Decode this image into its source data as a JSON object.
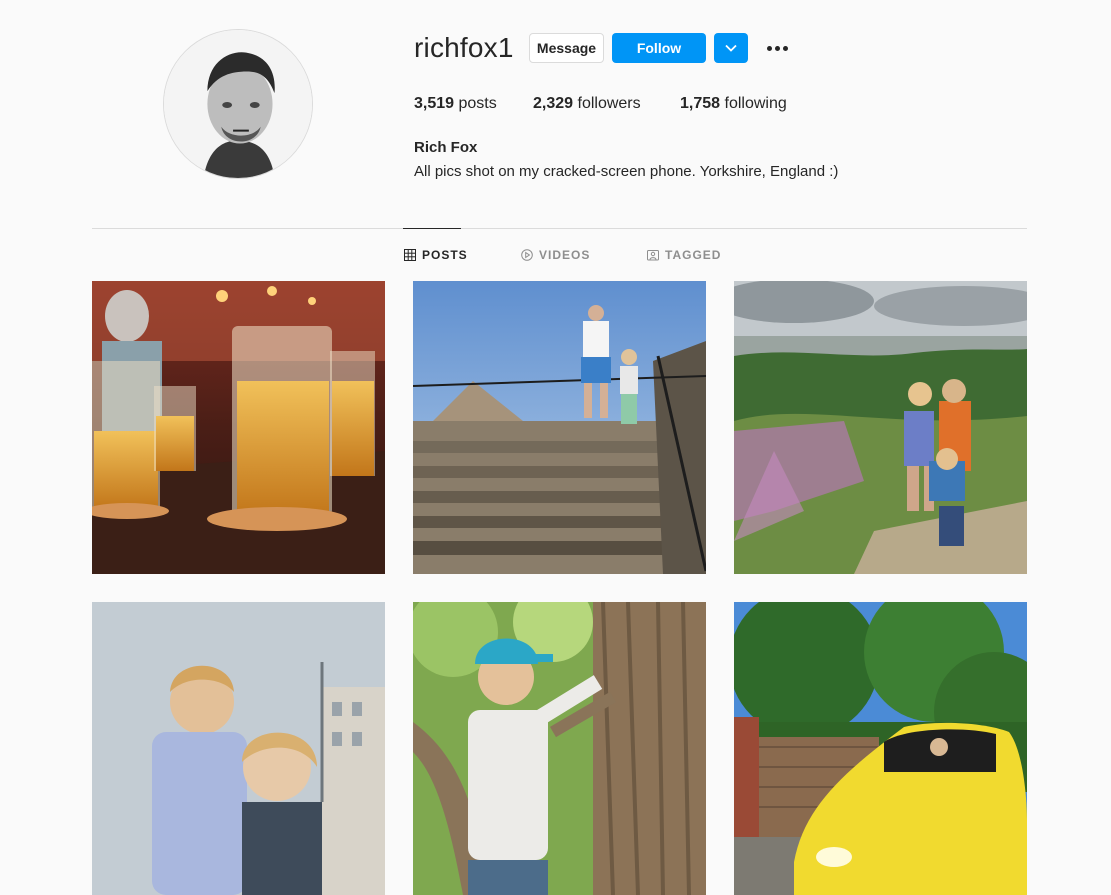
{
  "profile": {
    "username": "richfox1",
    "full_name": "Rich Fox",
    "bio": "All pics shot on my cracked-screen phone. Yorkshire, England :)"
  },
  "actions": {
    "message_label": "Message",
    "follow_label": "Follow"
  },
  "stats": {
    "posts_count": "3,519",
    "posts_label": "posts",
    "followers_count": "2,329",
    "followers_label": "followers",
    "following_count": "1,758",
    "following_label": "following"
  },
  "tabs": [
    {
      "label": "POSTS",
      "icon": "grid-icon",
      "active": true
    },
    {
      "label": "VIDEOS",
      "icon": "play-circle-icon",
      "active": false
    },
    {
      "label": "TAGGED",
      "icon": "tag-photo-icon",
      "active": false
    }
  ],
  "colors": {
    "accent": "#0095f6",
    "text": "#262626",
    "muted": "#8e8e8e",
    "background": "#fafafa",
    "border": "#dbdbdb"
  }
}
